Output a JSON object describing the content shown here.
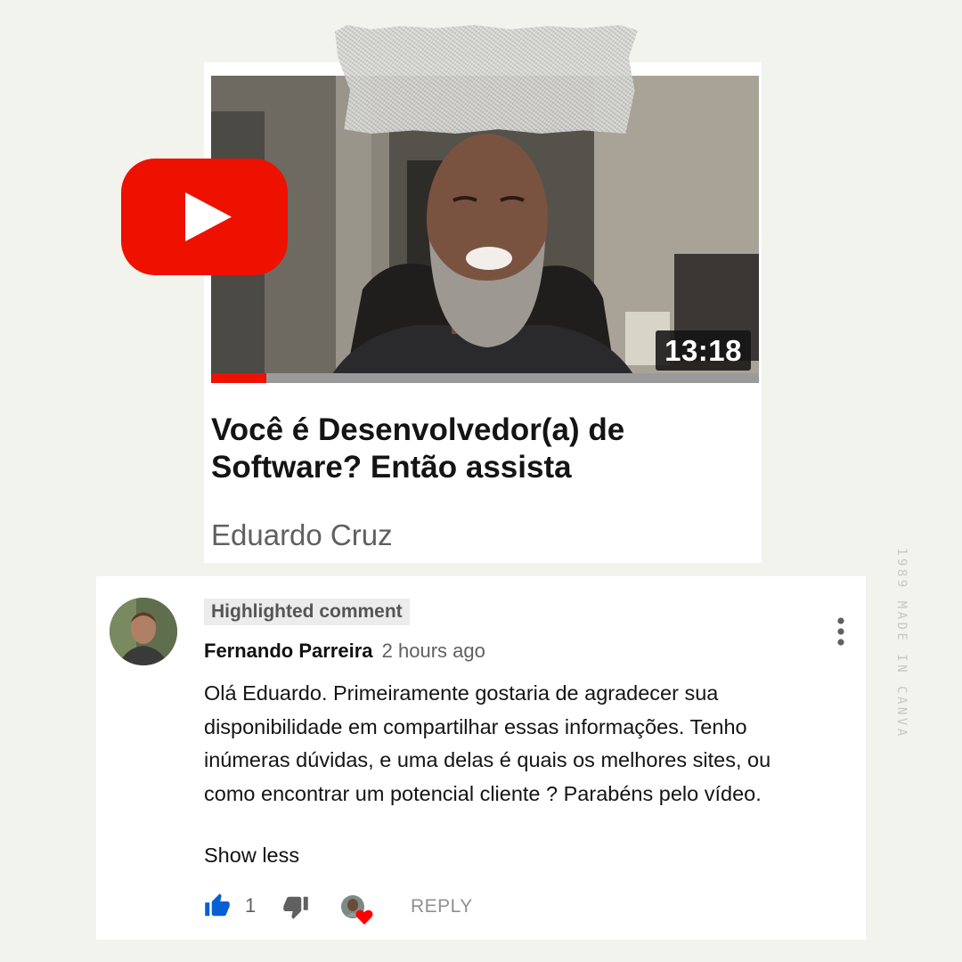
{
  "video": {
    "duration": "13:18",
    "progress": 0.1,
    "title": "Você é Desenvolvedor(a) de Software? Então assista",
    "channel": "Eduardo Cruz"
  },
  "comment": {
    "badge": "Highlighted comment",
    "author": "Fernando Parreira",
    "time": "2 hours ago",
    "text": "Olá Eduardo. Primeiramente gostaria de agradecer sua disponibilidade em compartilhar essas informações. Tenho inúmeras dúvidas, e uma delas é quais os melhores sites, ou como encontrar um potencial cliente ? Parabéns pelo vídeo.",
    "show_less": "Show less",
    "like_count": "1",
    "reply_label": "REPLY"
  },
  "watermark": "1989 MADE IN CANVA",
  "icons": {
    "logo": "youtube-play-icon",
    "like": "thumbs-up-icon",
    "dislike": "thumbs-down-icon",
    "menu": "more-vertical-icon",
    "heart": "creator-heart-icon"
  },
  "colors": {
    "youtube_red": "#ee1100",
    "like_blue": "#065fd4",
    "heart_red": "#ff0000",
    "background": "#f3f3ee"
  }
}
